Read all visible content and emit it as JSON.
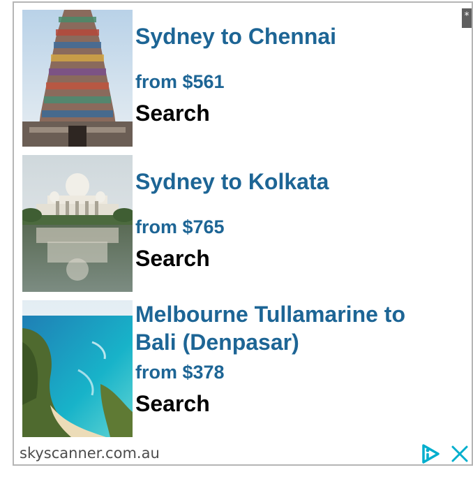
{
  "ad": {
    "corner_mark": "*",
    "offers": [
      {
        "image_icon": "temple-photo-icon",
        "route": "Sydney to Chennai",
        "price": "from $561",
        "cta": "Search"
      },
      {
        "image_icon": "palace-reflection-photo-icon",
        "route": "Sydney to Kolkata",
        "price": "from $765",
        "cta": "Search"
      },
      {
        "image_icon": "beach-cove-photo-icon",
        "route": "Melbourne Tullamarine to Bali (Denpasar)",
        "price": "from $378",
        "cta": "Search"
      }
    ],
    "footer": {
      "domain": "skyscanner.com.au",
      "adchoices_icon": "adchoices-icon",
      "close_icon": "close-icon"
    }
  },
  "colors": {
    "title_blue": "#1d6595",
    "cta_black": "#000000",
    "footer_text": "#4c4c4c",
    "border": "#b5b5b5",
    "icon_blue": "#00aecd"
  }
}
